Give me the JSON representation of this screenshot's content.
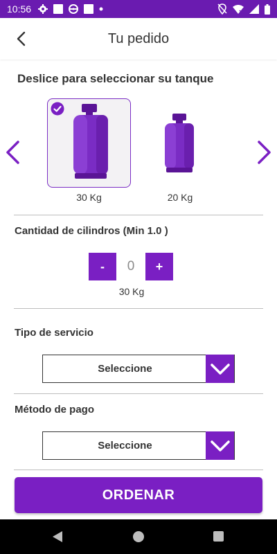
{
  "status_bar": {
    "time": "10:56",
    "left_icons": [
      "settings-icon",
      "square-icon",
      "steering-wheel-icon",
      "square-icon",
      "dot-icon"
    ],
    "right_icons": [
      "location-off-icon",
      "wifi-icon",
      "signal-icon",
      "battery-icon"
    ]
  },
  "header": {
    "title": "Tu pedido",
    "back_icon": "chevron-left-icon"
  },
  "tank_selector": {
    "title": "Deslice para seleccionar su tanque",
    "tanks": [
      {
        "label": "30 Kg",
        "selected": true
      },
      {
        "label": "20 Kg",
        "selected": false
      }
    ]
  },
  "quantity": {
    "title": "Cantidad de cilindros (Min 1.0 )",
    "minus_label": "-",
    "value": "0",
    "plus_label": "+",
    "unit_label": "30 Kg"
  },
  "service_type": {
    "title": "Tipo de servicio",
    "selected": "Seleccione"
  },
  "payment_method": {
    "title": "Método de pago",
    "selected": "Seleccione"
  },
  "order_button": {
    "label": "ORDENAR"
  },
  "colors": {
    "status_bar": "#6a1bb0",
    "accent": "#7a1fc3",
    "text": "#333333",
    "divider": "#bdbdbd"
  }
}
